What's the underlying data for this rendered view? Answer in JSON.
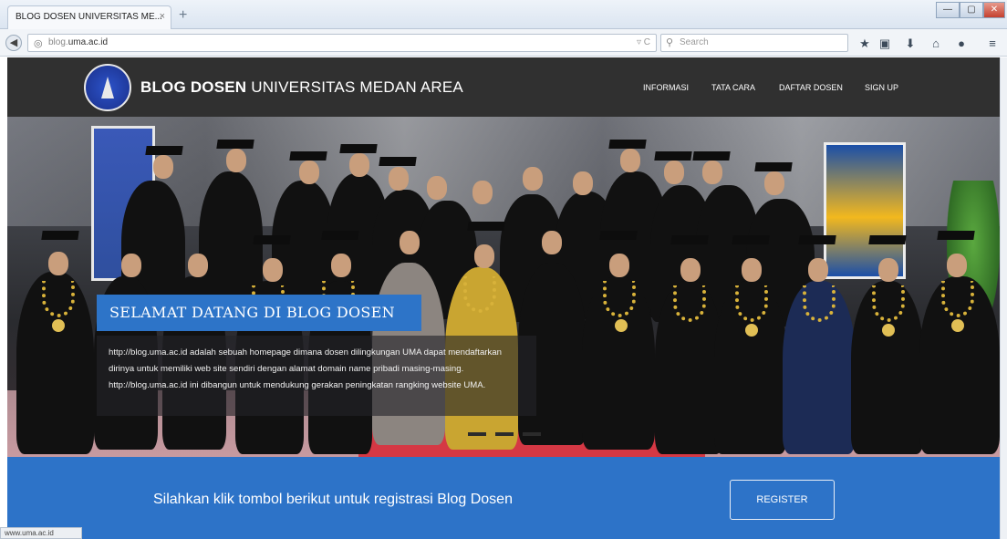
{
  "browser": {
    "tab_title": "BLOG DOSEN UNIVERSITAS ME...",
    "tab_close": "×",
    "new_tab": "+",
    "url_prefix": "blog.",
    "url_host": "uma.ac.id",
    "url_controls": "▿ C",
    "search_placeholder": "Search",
    "window_controls": {
      "minimize": "—",
      "maximize": "▢",
      "close": "✕"
    },
    "status_url": "www.uma.ac.id"
  },
  "site": {
    "brand_bold": "BLOG DOSEN",
    "brand_rest": " UNIVERSITAS MEDAN AREA",
    "nav": [
      "INFORMASI",
      "TATA CARA",
      "DAFTAR DOSEN",
      "SIGN UP"
    ],
    "hero": {
      "title": "SELAMAT DATANG DI BLOG DOSEN",
      "description": "http://blog.uma.ac.id adalah sebuah homepage dimana dosen dilingkungan UMA dapat mendaftarkan dirinya untuk memiliki web site sendiri dengan alamat domain name pribadi masing-masing. http://blog.uma.ac.id ini dibangun untuk mendukung gerakan peningkatan rangking website UMA."
    },
    "register": {
      "text": "Silahkan klik tombol berikut untuk registrasi Blog Dosen",
      "button": "REGISTER"
    }
  },
  "colors": {
    "header_bg": "#303030",
    "accent_blue": "#2d73c8",
    "carpet_red": "#d53844"
  },
  "icons": [
    "back-icon",
    "globe-icon",
    "search-icon",
    "star-icon",
    "clipboard-icon",
    "download-icon",
    "home-icon",
    "chat-icon",
    "menu-icon"
  ]
}
